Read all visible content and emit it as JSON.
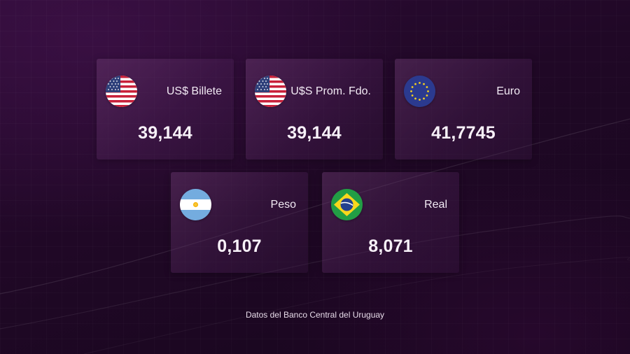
{
  "cards": [
    {
      "label": "US$ Billete",
      "value": "39,144",
      "flag_icon": "usa-flag-icon"
    },
    {
      "label": "U$S Prom. Fdo.",
      "value": "39,144",
      "flag_icon": "usa-flag-icon"
    },
    {
      "label": "Euro",
      "value": "41,7745",
      "flag_icon": "eu-flag-icon"
    },
    {
      "label": "Peso",
      "value": "0,107",
      "flag_icon": "argentina-flag-icon"
    },
    {
      "label": "Real",
      "value": "8,071",
      "flag_icon": "brazil-flag-icon"
    }
  ],
  "footer": {
    "text": "Datos del Banco Central del Uruguay"
  },
  "colors": {
    "background_top": "#2d0b36",
    "background_bottom": "#17061d",
    "card": "#5a2a66",
    "text": "#ffffff"
  }
}
